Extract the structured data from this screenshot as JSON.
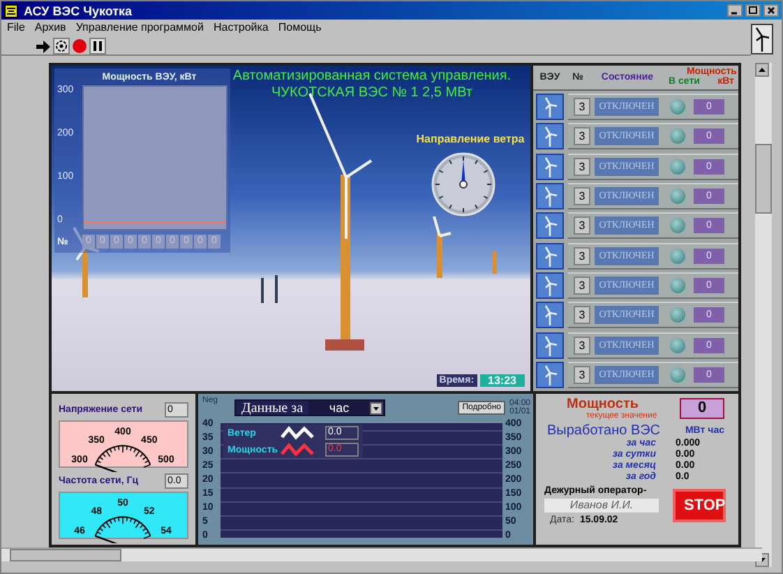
{
  "window": {
    "title": "АСУ ВЭС Чукотка"
  },
  "menu": [
    {
      "label": "File"
    },
    {
      "label": "Архив"
    },
    {
      "label": "Управление программой"
    },
    {
      "label": "Настройка"
    },
    {
      "label": "Помощь"
    }
  ],
  "photo_panel": {
    "header": [
      "Автоматизированная система управления.",
      "ЧУКОТСКАЯ  ВЭС № 1    2,5 МВт"
    ],
    "power_chart": {
      "title": "Мощность ВЭУ, кВт",
      "y_ticks": [
        "300",
        "200",
        "100",
        "0"
      ],
      "number_label": "№",
      "unit_values": [
        "0",
        "0",
        "0",
        "0",
        "0",
        "0",
        "0",
        "0",
        "0",
        "0"
      ]
    },
    "wind_direction": {
      "label": "Направление ветра"
    },
    "time": {
      "label": "Время:",
      "value": "13:23"
    }
  },
  "units_table": {
    "columns": [
      {
        "label": "ВЭУ",
        "kind": "plain"
      },
      {
        "label": "№",
        "kind": "plain"
      },
      {
        "label": "Состояние",
        "kind": "state"
      },
      {
        "label": "Мощность",
        "kind": "power"
      },
      {
        "label": "В сети",
        "kind": "online"
      },
      {
        "label": "кВт",
        "kind": "power"
      }
    ],
    "rows": [
      {
        "number": "3",
        "state": "ОТКЛЮЧЕН",
        "online": false,
        "power": "0"
      },
      {
        "number": "3",
        "state": "ОТКЛЮЧЕН",
        "online": false,
        "power": "0"
      },
      {
        "number": "3",
        "state": "ОТКЛЮЧЕН",
        "online": false,
        "power": "0"
      },
      {
        "number": "3",
        "state": "ОТКЛЮЧЕН",
        "online": false,
        "power": "0"
      },
      {
        "number": "3",
        "state": "ОТКЛЮЧЕН",
        "online": false,
        "power": "0"
      },
      {
        "number": "3",
        "state": "ОТКЛЮЧЕН",
        "online": false,
        "power": "0"
      },
      {
        "number": "3",
        "state": "ОТКЛЮЧЕН",
        "online": false,
        "power": "0"
      },
      {
        "number": "3",
        "state": "ОТКЛЮЧЕН",
        "online": false,
        "power": "0"
      },
      {
        "number": "3",
        "state": "ОТКЛЮЧЕН",
        "online": false,
        "power": "0"
      },
      {
        "number": "3",
        "state": "ОТКЛЮЧЕН",
        "online": false,
        "power": "0"
      }
    ]
  },
  "network": [
    {
      "label": "Напряжение сети",
      "value": "0",
      "scale": [
        "300",
        "350",
        "400",
        "450",
        "500"
      ],
      "color": "#ffc8c8"
    },
    {
      "label": "Частота сети, Гц",
      "value": "0.0",
      "scale": [
        "46",
        "48",
        "50",
        "52",
        "54"
      ],
      "color": "#30e8f8"
    }
  ],
  "trend": {
    "neg_label": "Neg",
    "period_label": "Данные за",
    "period": "час",
    "details_button": "Подробно",
    "time": "04:00",
    "date": "01/01",
    "legend": [
      {
        "name": "Ветер",
        "value": "0.0",
        "color": "#ffffff"
      },
      {
        "name": "Мощность",
        "value": "0.0",
        "color": "#ff3040"
      }
    ],
    "left_ticks": [
      "40",
      "35",
      "30",
      "25",
      "20",
      "15",
      "10",
      "5",
      "0"
    ],
    "right_ticks": [
      "400",
      "350",
      "300",
      "250",
      "200",
      "150",
      "100",
      "50",
      "0"
    ]
  },
  "summary": {
    "power_label": "Мощность",
    "power_sublabel": "текущее значение",
    "power_value": "0",
    "produced_title": "Выработано ВЭС",
    "unit": "МВт час",
    "periods": [
      {
        "label": "за час",
        "value": "0.000"
      },
      {
        "label": "за сутки",
        "value": "0.00"
      },
      {
        "label": "за месяц",
        "value": "0.00"
      },
      {
        "label": "за год",
        "value": "0.0"
      }
    ],
    "operator_label": "Дежурный оператор-",
    "operator": "Иванов И.И.",
    "date_label": "Дата:",
    "date": "15.09.02",
    "stop_button": "STOP"
  }
}
